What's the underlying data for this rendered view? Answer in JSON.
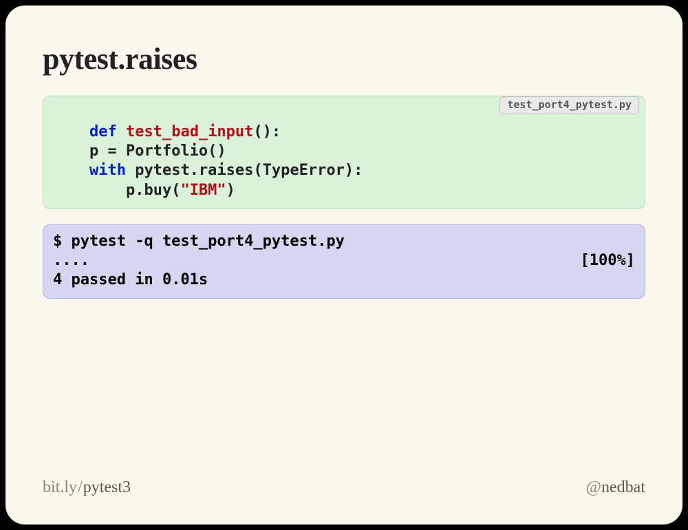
{
  "title": "pytest.raises",
  "code": {
    "filename": "test_port4_pytest.py",
    "kw_def": "def",
    "fn_name": "test_bad_input",
    "paren_open_close_colon": "():",
    "line2_indent": "    p = Portfolio()",
    "kw_with": "with",
    "raises_call": " pytest.raises(TypeError):",
    "line4_indent_pre": "        p.buy(",
    "str_ibm": "\"IBM\"",
    "line4_indent_post": ")"
  },
  "shell": {
    "cmd": "$ pytest -q test_port4_pytest.py",
    "dots": "....",
    "pct": "[100%]",
    "summary": "4 passed in 0.01s"
  },
  "footer": {
    "left_prefix": "bit.ly",
    "left_slash": "/",
    "left_suffix": "pytest3",
    "right_at": "@",
    "right_name": "nedbat"
  }
}
